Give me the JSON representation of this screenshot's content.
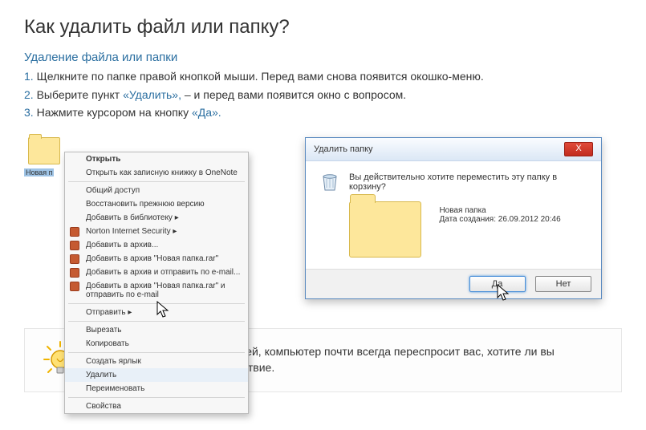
{
  "title": "Как удалить файл или папку?",
  "subheading": "Удаление файла или папки",
  "steps": [
    {
      "num": "1.",
      "text": "Щелкните по папке правой кнопкой мыши. Перед вами снова появится окошко-меню."
    },
    {
      "num": "2.",
      "pre": "Выберите пункт ",
      "hl": "«Удалить»,",
      "post": " – и перед вами появится окно с вопросом."
    },
    {
      "num": "3.",
      "pre": "Нажмите курсором на кнопку ",
      "hl": "«Да».",
      "post": ""
    }
  ],
  "desktop_folder": {
    "label": "Новая п"
  },
  "context_menu": {
    "items": [
      {
        "label": "Открыть",
        "bold": true
      },
      {
        "label": "Открыть как записную книжку в OneNote"
      },
      {
        "sep": true
      },
      {
        "label": "Общий доступ"
      },
      {
        "label": "Восстановить прежнюю версию"
      },
      {
        "label": "Добавить в библиотеку",
        "arrow": true
      },
      {
        "label": "Norton Internet Security",
        "arrow": true,
        "icon": true
      },
      {
        "label": "Добавить в архив...",
        "icon": true
      },
      {
        "label": "Добавить в архив \"Новая папка.rar\"",
        "icon": true
      },
      {
        "label": "Добавить в архив и отправить по e-mail...",
        "icon": true
      },
      {
        "label": "Добавить в архив \"Новая папка.rar\" и отправить по e-mail",
        "icon": true
      },
      {
        "sep": true
      },
      {
        "label": "Отправить",
        "arrow": true
      },
      {
        "sep": true
      },
      {
        "label": "Вырезать"
      },
      {
        "label": "Копировать"
      },
      {
        "sep": true
      },
      {
        "label": "Создать ярлык"
      },
      {
        "label": "Удалить",
        "hover": true
      },
      {
        "label": "Переименовать"
      },
      {
        "sep": true
      },
      {
        "label": "Свойства"
      }
    ]
  },
  "dialog": {
    "title": "Удалить папку",
    "close_label": "X",
    "question": "Вы действительно хотите переместить эту папку в корзину?",
    "folder_name": "Новая папка",
    "created": "Дата создания: 26.09.2012 20:46",
    "yes": "Да",
    "no": "Нет"
  },
  "tip": "Чтобы избежать случайностей, компьютер почти всегда переспросит вас, хотите ли вы совершить то или иное действие."
}
